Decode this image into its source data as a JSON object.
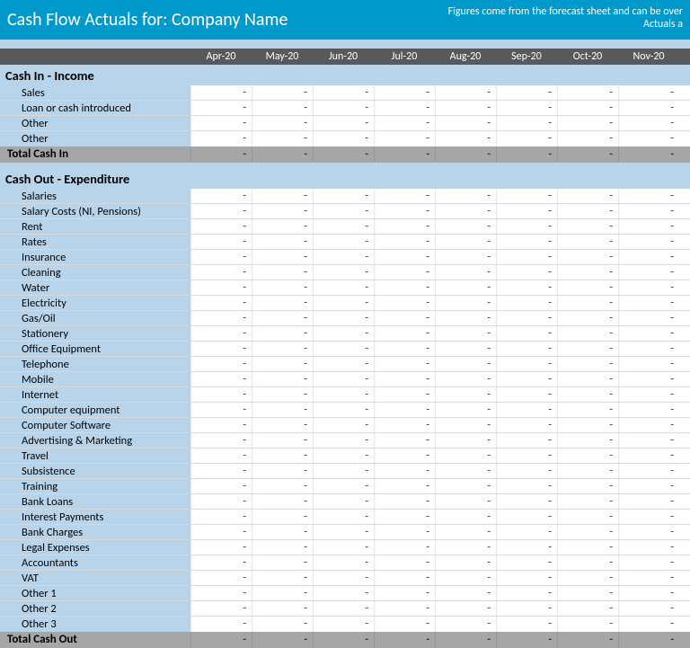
{
  "banner": {
    "title_prefix": "Cash Flow Actuals for:  ",
    "company": "Company Name",
    "note_line1": "Figures come from the forecast sheet and can be over",
    "note_line2": "Actuals a"
  },
  "months": [
    "Apr-20",
    "May-20",
    "Jun-20",
    "Jul-20",
    "Aug-20",
    "Sep-20",
    "Oct-20",
    "Nov-20"
  ],
  "cash_in": {
    "title": "Cash In - Income",
    "items": [
      "Sales",
      "Loan or cash introduced",
      "Other",
      "Other"
    ],
    "total_label": "Total Cash In"
  },
  "cash_out": {
    "title": "Cash Out - Expenditure",
    "items": [
      "Salaries",
      "Salary Costs (NI, Pensions)",
      "Rent",
      "Rates",
      "Insurance",
      "Cleaning",
      "Water",
      "Electricity",
      "Gas/Oil",
      "Stationery",
      "Office Equipment",
      "Telephone",
      "Mobile",
      "Internet",
      "Computer equipment",
      "Computer Software",
      "Advertising & Marketing",
      "Travel",
      "Subsistence",
      "Training",
      "Bank Loans",
      "Interest Payments",
      "Bank Charges",
      "Legal Expenses",
      "Accountants",
      "VAT",
      "Other 1",
      "Other 2",
      "Other 3"
    ],
    "total_label": "Total Cash Out"
  },
  "empty_value": "-"
}
